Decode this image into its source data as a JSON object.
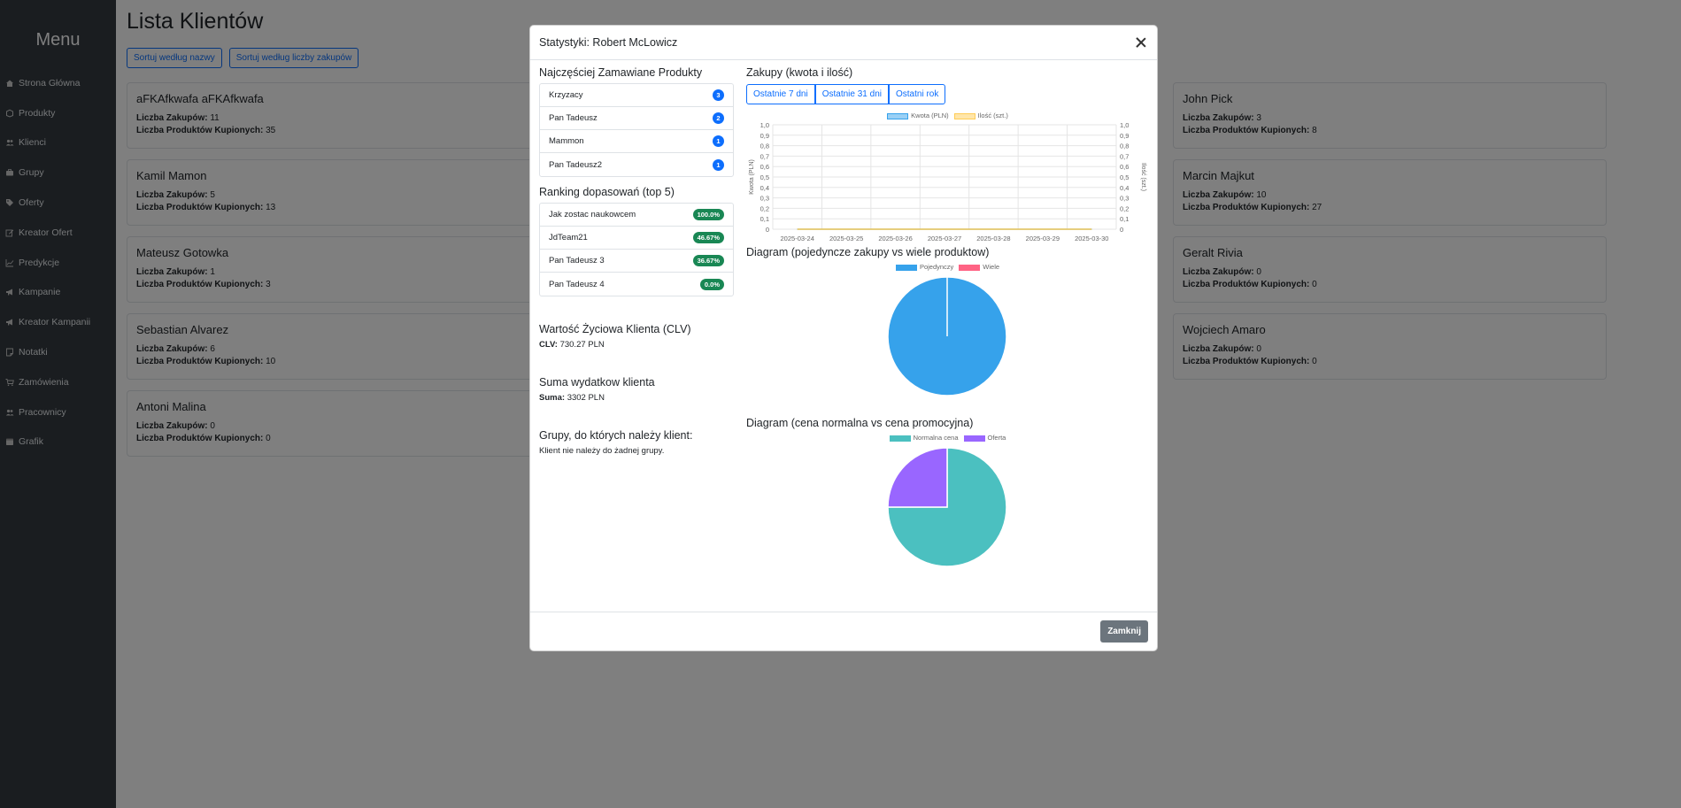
{
  "sidebar": {
    "title": "Menu",
    "items": [
      {
        "label": "Strona Główna",
        "icon": "home-icon"
      },
      {
        "label": "Produkty",
        "icon": "box-icon"
      },
      {
        "label": "Klienci",
        "icon": "users-icon"
      },
      {
        "label": "Grupy",
        "icon": "briefcase-icon"
      },
      {
        "label": "Oferty",
        "icon": "tag-icon"
      },
      {
        "label": "Kreator Ofert",
        "icon": "pencil-square-icon"
      },
      {
        "label": "Predykcje",
        "icon": "chart-line-icon"
      },
      {
        "label": "Kampanie",
        "icon": "megaphone-icon"
      },
      {
        "label": "Kreator Kampanii",
        "icon": "megaphone-icon"
      },
      {
        "label": "Notatki",
        "icon": "note-icon"
      },
      {
        "label": "Zamówienia",
        "icon": "cart-icon"
      },
      {
        "label": "Pracownicy",
        "icon": "users-icon"
      },
      {
        "label": "Grafik",
        "icon": "calendar-icon"
      }
    ]
  },
  "main": {
    "title": "Lista Klientów",
    "sort_by_name": "Sortuj według nazwy",
    "sort_by_purchases": "Sortuj według liczby zakupów",
    "purchases_label": "Liczba Zakupów:",
    "products_label": "Liczba Produktów Kupionych:",
    "clients_left": [
      {
        "name": "aFKAfkwafa aFKAfkwafa",
        "purchases": "11",
        "products": "35"
      },
      {
        "name": "Kamil Mamon",
        "purchases": "5",
        "products": "13"
      },
      {
        "name": "Mateusz Gotowka",
        "purchases": "1",
        "products": "3"
      },
      {
        "name": "Sebastian Alvarez",
        "purchases": "6",
        "products": "10"
      },
      {
        "name": "Antoni Malina",
        "purchases": "0",
        "products": "0"
      }
    ],
    "clients_right": [
      {
        "name": "John Pick",
        "purchases": "3",
        "products": "8"
      },
      {
        "name": "Marcin Majkut",
        "purchases": "10",
        "products": "27"
      },
      {
        "name": "Geralt Rivia",
        "purchases": "0",
        "products": "0"
      },
      {
        "name": "Wojciech Amaro",
        "purchases": "0",
        "products": "0"
      }
    ]
  },
  "modal": {
    "title": "Statystyki: Robert McLowicz",
    "close_label": "Zamknij",
    "top_products": {
      "heading": "Najczęściej Zamawiane Produkty",
      "items": [
        {
          "label": "Krzyzacy",
          "count": "3"
        },
        {
          "label": "Pan Tadeusz",
          "count": "2"
        },
        {
          "label": "Mammon",
          "count": "1"
        },
        {
          "label": "Pan Tadeusz2",
          "count": "1"
        }
      ]
    },
    "ranking": {
      "heading": "Ranking dopasowań (top 5)",
      "items": [
        {
          "label": "Jak zostac naukowcem",
          "score": "100.0%"
        },
        {
          "label": "JdTeam21",
          "score": "46.67%"
        },
        {
          "label": "Pan Tadeusz 3",
          "score": "36.67%"
        },
        {
          "label": "Pan Tadeusz 4",
          "score": "0.0%"
        }
      ]
    },
    "clv": {
      "heading": "Wartość Życiowa Klienta (CLV)",
      "label": "CLV:",
      "value": "730.27 PLN"
    },
    "spending": {
      "heading": "Suma wydatkow klienta",
      "label": "Suma:",
      "value": "3302 PLN"
    },
    "groups": {
      "heading": "Grupy, do których należy klient:",
      "text": "Klient nie należy do żadnej grupy."
    },
    "purchases_chart": {
      "heading": "Zakupy (kwota i ilość)",
      "ranges": [
        "Ostatnie 7 dni",
        "Ostatnie 31 dni",
        "Ostatni rok"
      ]
    },
    "single_multi_heading": "Diagram (pojedyncze zakupy vs wiele produktow)",
    "price_heading": "Diagram (cena normalna vs cena promocyjna)"
  },
  "chart_data": [
    {
      "type": "line",
      "x": [
        "2025-03-24",
        "2025-03-25",
        "2025-03-26",
        "2025-03-27",
        "2025-03-28",
        "2025-03-29",
        "2025-03-30"
      ],
      "series": [
        {
          "name": "Kwota (PLN)",
          "values": [
            0,
            0,
            0,
            0,
            0,
            0,
            0
          ],
          "color": "#36a2eb"
        },
        {
          "name": "Ilość (szt.)",
          "values": [
            0,
            0,
            0,
            0,
            0,
            0,
            0
          ],
          "color": "#ffcd56"
        }
      ],
      "ylabel": "Kwota (PLN)",
      "y2label": "Ilość (szt.)",
      "ylim": [
        0,
        1
      ],
      "yticks": [
        "0",
        "0,1",
        "0,2",
        "0,3",
        "0,4",
        "0,5",
        "0,6",
        "0,7",
        "0,8",
        "0,9",
        "1,0"
      ],
      "grid": true,
      "legend": "top"
    },
    {
      "type": "pie",
      "categories": [
        "Pojedynczy",
        "Wiele"
      ],
      "values": [
        100,
        0
      ],
      "colors": [
        "#36a2eb",
        "#ff6384"
      ],
      "legend": "top"
    },
    {
      "type": "pie",
      "categories": [
        "Normalna cena",
        "Oferta"
      ],
      "values": [
        75,
        25
      ],
      "colors": [
        "#4bc0c0",
        "#9966ff"
      ],
      "legend": "top"
    }
  ]
}
